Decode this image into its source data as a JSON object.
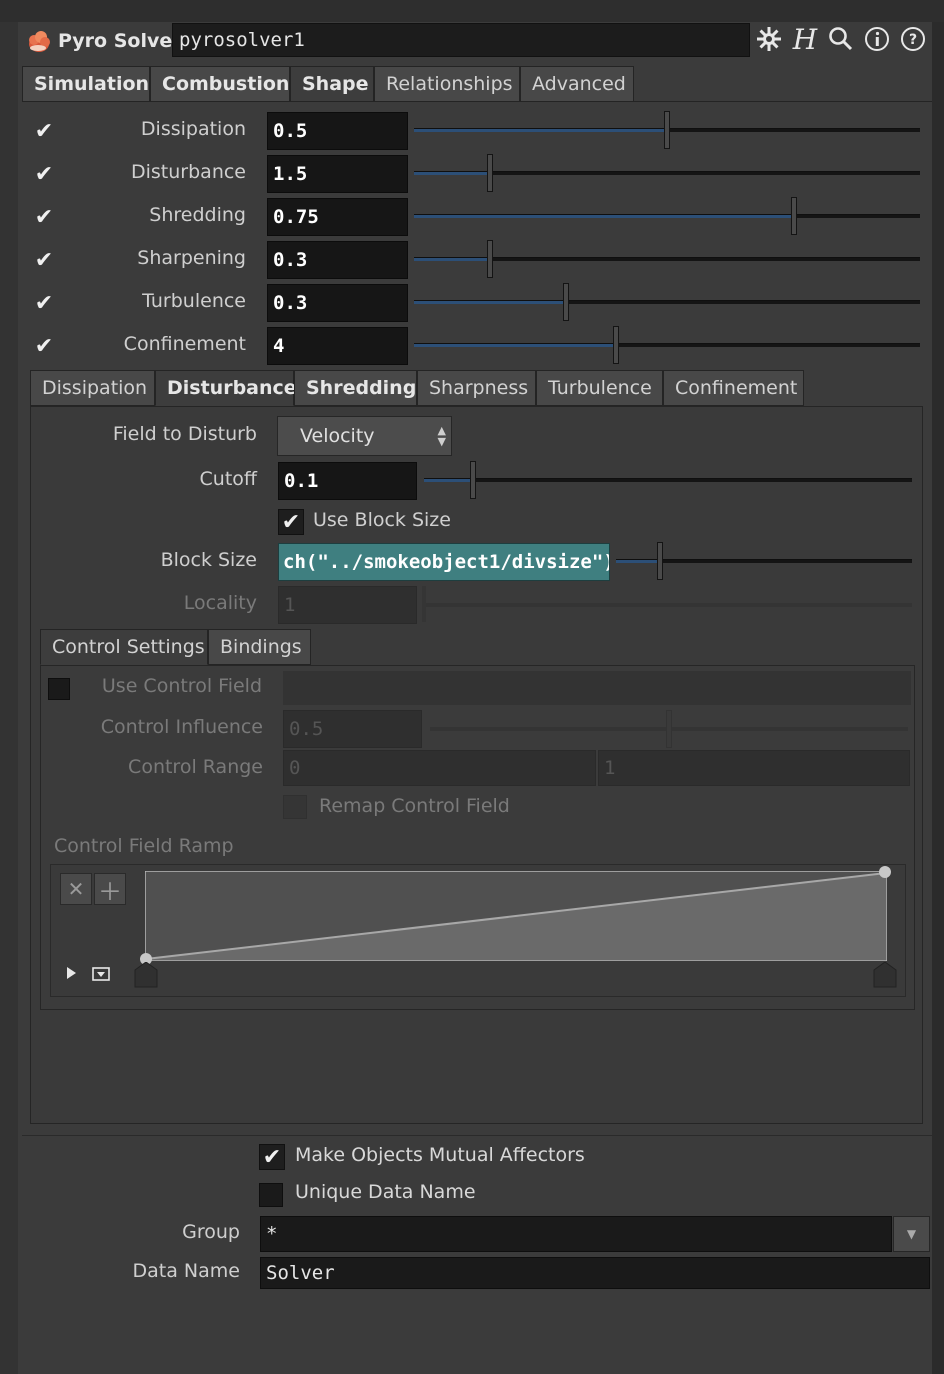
{
  "header": {
    "node_type": "Pyro Solver",
    "node_name": "pyrosolver1",
    "icons": [
      "gear-icon",
      "houdini-h-icon",
      "search-icon",
      "info-icon",
      "help-icon"
    ]
  },
  "main_tabs": [
    {
      "label": "Simulation",
      "bold": true
    },
    {
      "label": "Combustion",
      "bold": true
    },
    {
      "label": "Shape",
      "bold": true,
      "active": true
    },
    {
      "label": "Relationships",
      "bold": false
    },
    {
      "label": "Advanced",
      "bold": false
    }
  ],
  "shape_params": [
    {
      "label": "Dissipation",
      "value": "0.5",
      "enabled": true,
      "slider_fraction": 0.5
    },
    {
      "label": "Disturbance",
      "value": "1.5",
      "enabled": true,
      "slider_fraction": 0.15
    },
    {
      "label": "Shredding",
      "value": "0.75",
      "enabled": true,
      "slider_fraction": 0.75
    },
    {
      "label": "Sharpening",
      "value": "0.3",
      "enabled": true,
      "slider_fraction": 0.15
    },
    {
      "label": "Turbulence",
      "value": "0.3",
      "enabled": true,
      "slider_fraction": 0.3
    },
    {
      "label": "Confinement",
      "value": "4",
      "enabled": true,
      "slider_fraction": 0.4
    }
  ],
  "sub_tabs": [
    {
      "label": "Dissipation",
      "bold": false
    },
    {
      "label": "Disturbance",
      "bold": true,
      "active": true
    },
    {
      "label": "Shredding",
      "bold": true
    },
    {
      "label": "Sharpness",
      "bold": false
    },
    {
      "label": "Turbulence",
      "bold": false
    },
    {
      "label": "Confinement",
      "bold": false
    }
  ],
  "disturbance": {
    "field_to_disturb_label": "Field to Disturb",
    "field_to_disturb_value": "Velocity",
    "cutoff_label": "Cutoff",
    "cutoff_value": "0.1",
    "cutoff_fraction": 0.1,
    "use_block_size_label": "Use Block Size",
    "use_block_size_checked": true,
    "block_size_label": "Block Size",
    "block_size_value": "ch(\"../smokeobject1/divsize\")",
    "block_size_fraction": 0.15,
    "locality_label": "Locality",
    "locality_value": "1"
  },
  "control_tabs": [
    {
      "label": "Control Settings",
      "active": true
    },
    {
      "label": "Bindings",
      "active": false
    }
  ],
  "control": {
    "use_control_field_label": "Use Control Field",
    "control_influence_label": "Control Influence",
    "control_influence_value": "0.5",
    "control_influence_fraction": 0.5,
    "control_range_label": "Control Range",
    "control_range_min": "0",
    "control_range_max": "1",
    "remap_label": "Remap Control Field",
    "ramp_label": "Control Field Ramp",
    "ramp_points": [
      {
        "pos": 0,
        "value": 0
      },
      {
        "pos": 1,
        "value": 1
      }
    ]
  },
  "bottom": {
    "mutual_affectors_label": "Make Objects Mutual Affectors",
    "mutual_affectors_checked": true,
    "unique_data_label": "Unique Data Name",
    "unique_data_checked": false,
    "group_label": "Group",
    "group_value": "*",
    "data_name_label": "Data Name",
    "data_name_value": "Solver"
  },
  "colors": {
    "panel_bg": "#3b3b3b",
    "field_bg": "#161616",
    "slider_fill": "#2c4f77",
    "expression_bg": "#3f7f80"
  }
}
